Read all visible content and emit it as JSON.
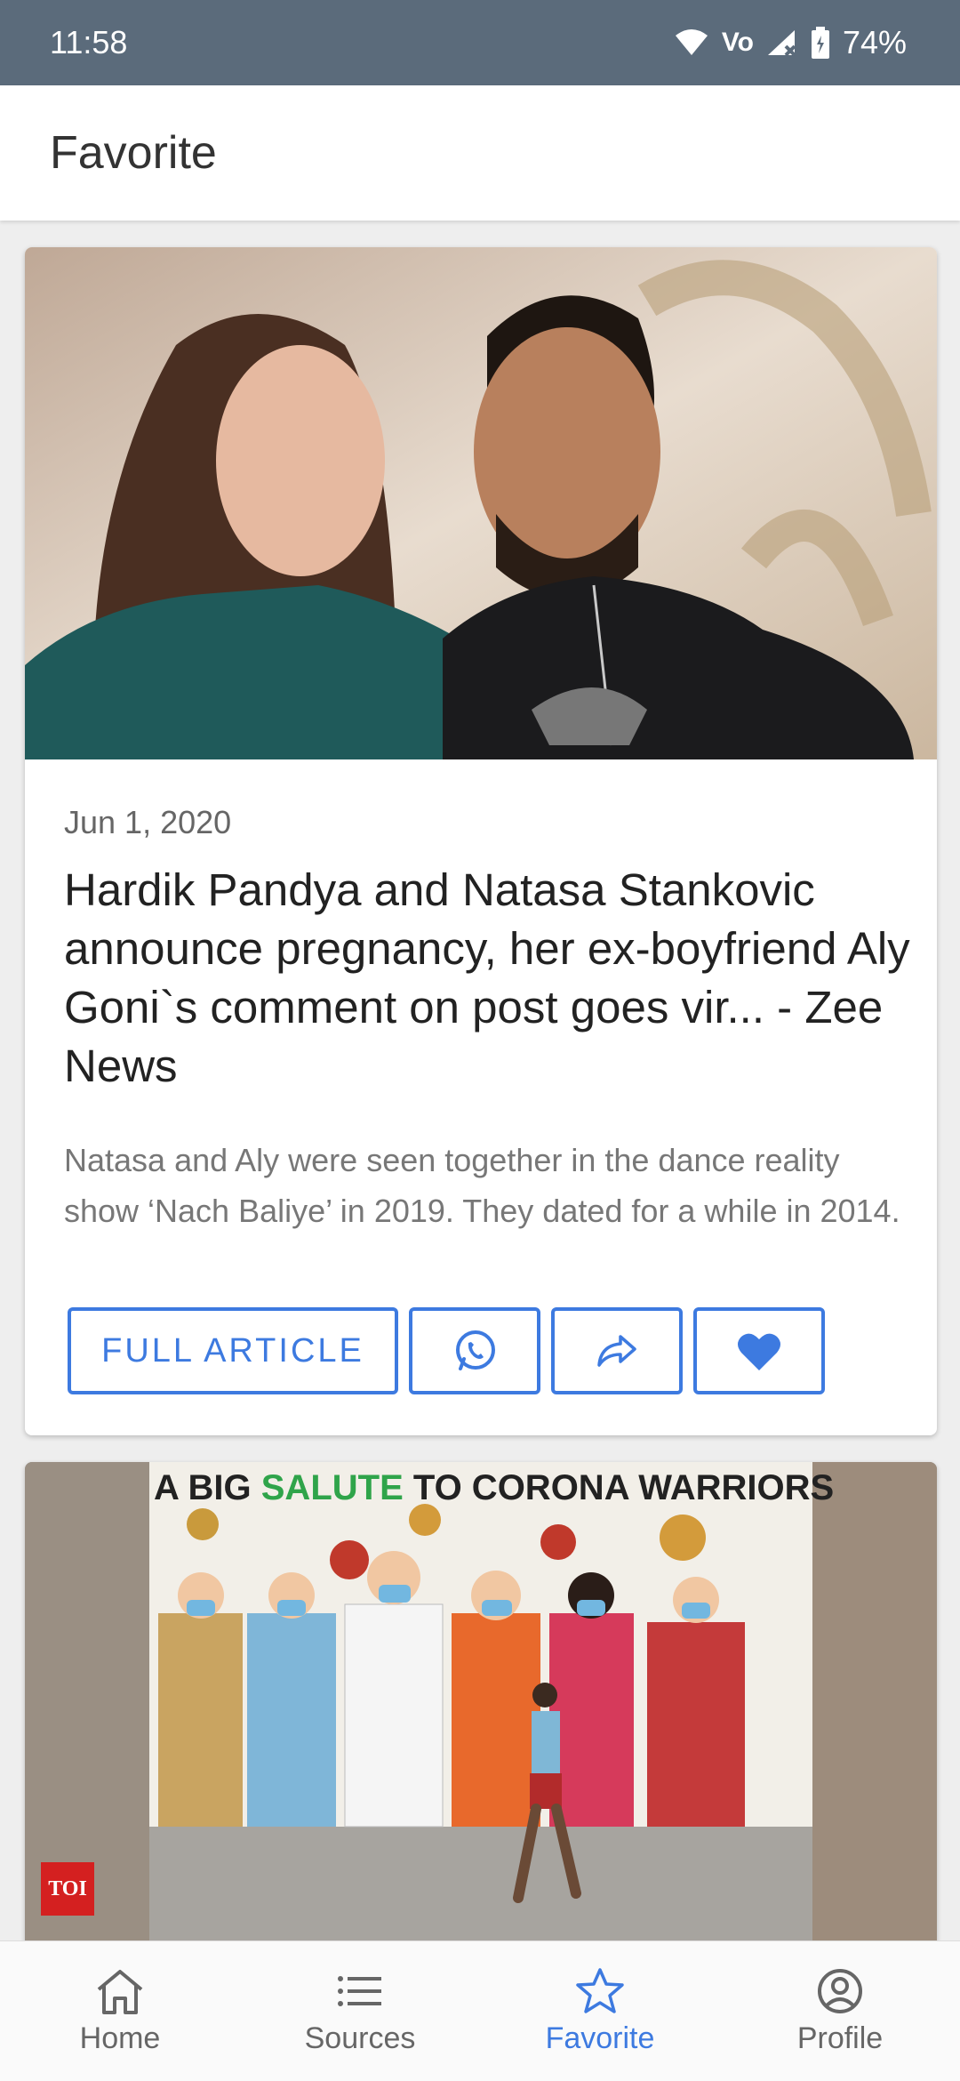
{
  "status_bar": {
    "time": "11:58",
    "battery": "74%",
    "network": "Vo"
  },
  "app_bar": {
    "title": "Favorite"
  },
  "articles": [
    {
      "date": "Jun 1, 2020",
      "title": "Hardik Pandya and Natasa Stankovic announce pregnancy, her ex-boyfriend Aly Goni`s comment on post goes vir... - Zee News",
      "description": "Natasa and Aly were seen together in the dance reality show ‘Nach Baliye’ in 2019. They dated for a while in 2014.",
      "actions": {
        "full_article": "FULL ARTICLE"
      }
    },
    {
      "image_text": {
        "line_prefix": "A BIG ",
        "highlight": "SALUTE",
        "line_suffix": " TO CORONA WARRIORS"
      },
      "source_badge": "TOI"
    }
  ],
  "bottom_nav": [
    {
      "label": "Home",
      "icon": "home-icon"
    },
    {
      "label": "Sources",
      "icon": "list-icon"
    },
    {
      "label": "Favorite",
      "icon": "star-icon",
      "active": true
    },
    {
      "label": "Profile",
      "icon": "profile-icon"
    }
  ],
  "colors": {
    "accent": "#3d7ae0",
    "status_bar": "#5b6b7b"
  }
}
